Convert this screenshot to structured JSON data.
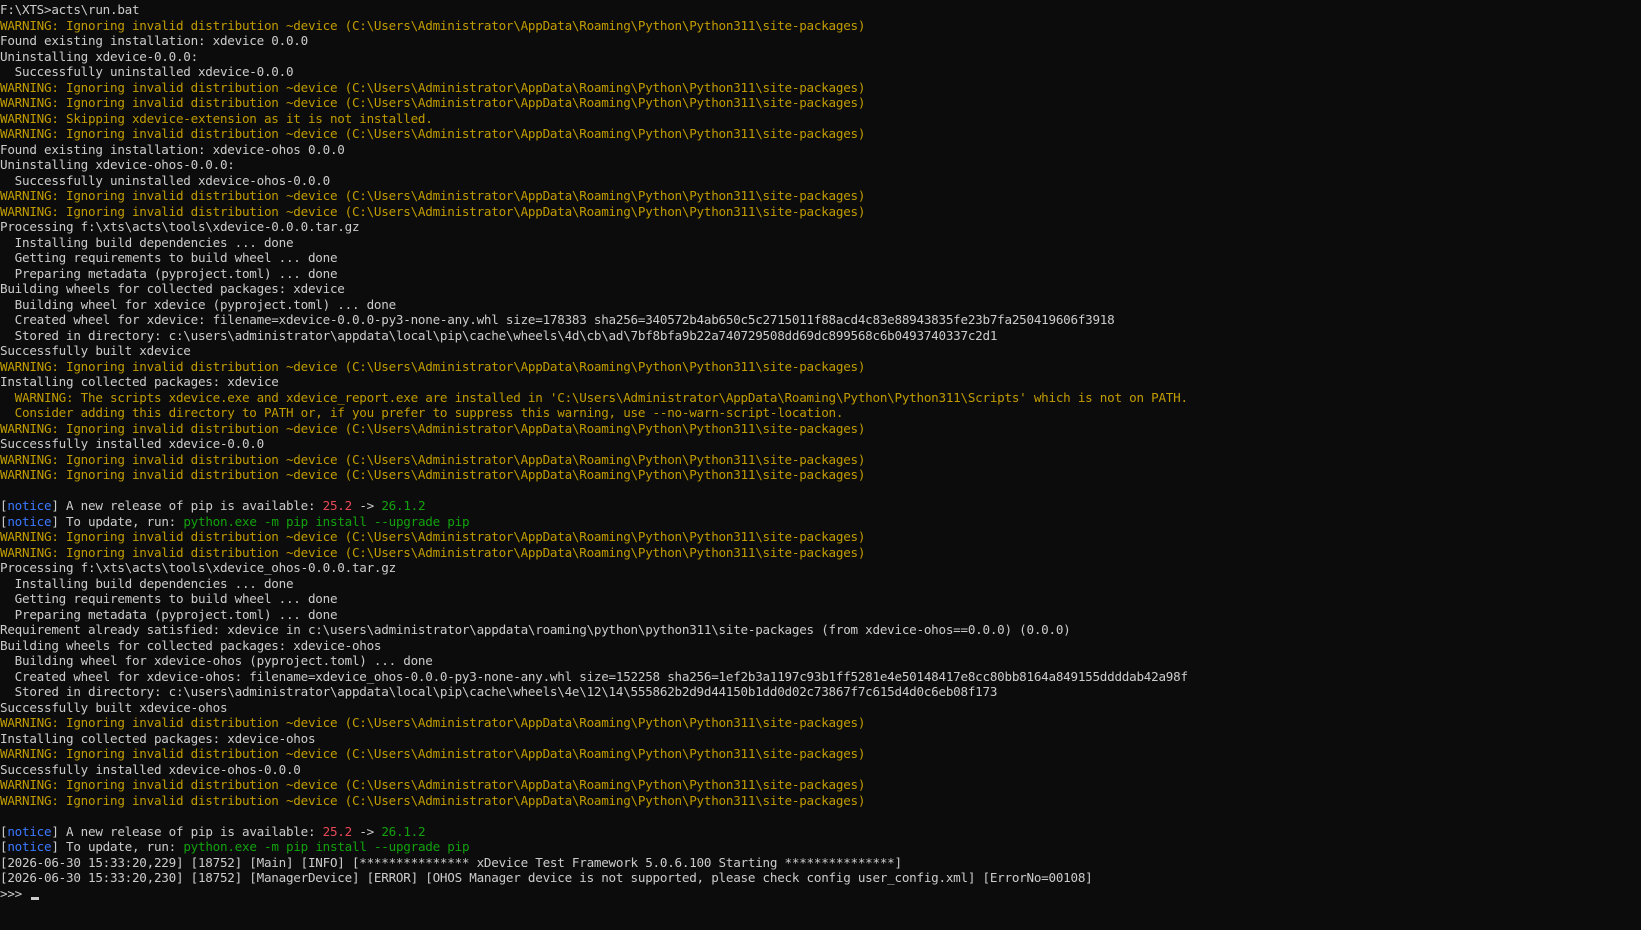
{
  "colors": {
    "background": "#0c0c0c",
    "text": "#cccccc",
    "warning": "#c19c00",
    "notice": "#3b78ff",
    "old_version": "#e74856",
    "new_version": "#13a10e"
  },
  "lines": [
    {
      "type": "n",
      "text": "F:\\XTS>acts\\run.bat"
    },
    {
      "type": "w",
      "text": "WARNING: Ignoring invalid distribution ~device (C:\\Users\\Administrator\\AppData\\Roaming\\Python\\Python311\\site-packages)"
    },
    {
      "type": "n",
      "text": "Found existing installation: xdevice 0.0.0"
    },
    {
      "type": "n",
      "text": "Uninstalling xdevice-0.0.0:"
    },
    {
      "type": "n",
      "text": "  Successfully uninstalled xdevice-0.0.0"
    },
    {
      "type": "w",
      "text": "WARNING: Ignoring invalid distribution ~device (C:\\Users\\Administrator\\AppData\\Roaming\\Python\\Python311\\site-packages)"
    },
    {
      "type": "w",
      "text": "WARNING: Ignoring invalid distribution ~device (C:\\Users\\Administrator\\AppData\\Roaming\\Python\\Python311\\site-packages)"
    },
    {
      "type": "w",
      "text": "WARNING: Skipping xdevice-extension as it is not installed."
    },
    {
      "type": "w",
      "text": "WARNING: Ignoring invalid distribution ~device (C:\\Users\\Administrator\\AppData\\Roaming\\Python\\Python311\\site-packages)"
    },
    {
      "type": "n",
      "text": "Found existing installation: xdevice-ohos 0.0.0"
    },
    {
      "type": "n",
      "text": "Uninstalling xdevice-ohos-0.0.0:"
    },
    {
      "type": "n",
      "text": "  Successfully uninstalled xdevice-ohos-0.0.0"
    },
    {
      "type": "w",
      "text": "WARNING: Ignoring invalid distribution ~device (C:\\Users\\Administrator\\AppData\\Roaming\\Python\\Python311\\site-packages)"
    },
    {
      "type": "w",
      "text": "WARNING: Ignoring invalid distribution ~device (C:\\Users\\Administrator\\AppData\\Roaming\\Python\\Python311\\site-packages)"
    },
    {
      "type": "n",
      "text": "Processing f:\\xts\\acts\\tools\\xdevice-0.0.0.tar.gz"
    },
    {
      "type": "n",
      "text": "  Installing build dependencies ... done"
    },
    {
      "type": "n",
      "text": "  Getting requirements to build wheel ... done"
    },
    {
      "type": "n",
      "text": "  Preparing metadata (pyproject.toml) ... done"
    },
    {
      "type": "n",
      "text": "Building wheels for collected packages: xdevice"
    },
    {
      "type": "n",
      "text": "  Building wheel for xdevice (pyproject.toml) ... done"
    },
    {
      "type": "n",
      "text": "  Created wheel for xdevice: filename=xdevice-0.0.0-py3-none-any.whl size=178383 sha256=340572b4ab650c5c2715011f88acd4c83e88943835fe23b7fa250419606f3918"
    },
    {
      "type": "n",
      "text": "  Stored in directory: c:\\users\\administrator\\appdata\\local\\pip\\cache\\wheels\\4d\\cb\\ad\\7bf8bfa9b22a740729508dd69dc899568c6b0493740337c2d1"
    },
    {
      "type": "n",
      "text": "Successfully built xdevice"
    },
    {
      "type": "w",
      "text": "WARNING: Ignoring invalid distribution ~device (C:\\Users\\Administrator\\AppData\\Roaming\\Python\\Python311\\site-packages)"
    },
    {
      "type": "n",
      "text": "Installing collected packages: xdevice"
    },
    {
      "type": "w",
      "text": "  WARNING: The scripts xdevice.exe and xdevice_report.exe are installed in 'C:\\Users\\Administrator\\AppData\\Roaming\\Python\\Python311\\Scripts' which is not on PATH."
    },
    {
      "type": "w",
      "text": "  Consider adding this directory to PATH or, if you prefer to suppress this warning, use --no-warn-script-location."
    },
    {
      "type": "w",
      "text": "WARNING: Ignoring invalid distribution ~device (C:\\Users\\Administrator\\AppData\\Roaming\\Python\\Python311\\site-packages)"
    },
    {
      "type": "n",
      "text": "Successfully installed xdevice-0.0.0"
    },
    {
      "type": "w",
      "text": "WARNING: Ignoring invalid distribution ~device (C:\\Users\\Administrator\\AppData\\Roaming\\Python\\Python311\\site-packages)"
    },
    {
      "type": "w",
      "text": "WARNING: Ignoring invalid distribution ~device (C:\\Users\\Administrator\\AppData\\Roaming\\Python\\Python311\\site-packages)"
    },
    {
      "type": "blank",
      "text": ""
    },
    {
      "type": "notice_release",
      "tag": "notice",
      "text": "A new release of pip is available: ",
      "old": "25.2",
      "arrow": " -> ",
      "new": "26.1.2"
    },
    {
      "type": "notice_update",
      "tag": "notice",
      "text": "To update, run: ",
      "cmd": "python.exe -m pip install --upgrade pip"
    },
    {
      "type": "w",
      "text": "WARNING: Ignoring invalid distribution ~device (C:\\Users\\Administrator\\AppData\\Roaming\\Python\\Python311\\site-packages)"
    },
    {
      "type": "w",
      "text": "WARNING: Ignoring invalid distribution ~device (C:\\Users\\Administrator\\AppData\\Roaming\\Python\\Python311\\site-packages)"
    },
    {
      "type": "n",
      "text": "Processing f:\\xts\\acts\\tools\\xdevice_ohos-0.0.0.tar.gz"
    },
    {
      "type": "n",
      "text": "  Installing build dependencies ... done"
    },
    {
      "type": "n",
      "text": "  Getting requirements to build wheel ... done"
    },
    {
      "type": "n",
      "text": "  Preparing metadata (pyproject.toml) ... done"
    },
    {
      "type": "n",
      "text": "Requirement already satisfied: xdevice in c:\\users\\administrator\\appdata\\roaming\\python\\python311\\site-packages (from xdevice-ohos==0.0.0) (0.0.0)"
    },
    {
      "type": "n",
      "text": "Building wheels for collected packages: xdevice-ohos"
    },
    {
      "type": "n",
      "text": "  Building wheel for xdevice-ohos (pyproject.toml) ... done"
    },
    {
      "type": "n",
      "text": "  Created wheel for xdevice-ohos: filename=xdevice_ohos-0.0.0-py3-none-any.whl size=152258 sha256=1ef2b3a1197c93b1ff5281e4e50148417e8cc80bb8164a849155ddddab42a98f"
    },
    {
      "type": "n",
      "text": "  Stored in directory: c:\\users\\administrator\\appdata\\local\\pip\\cache\\wheels\\4e\\12\\14\\555862b2d9d44150b1dd0d02c73867f7c615d4d0c6eb08f173"
    },
    {
      "type": "n",
      "text": "Successfully built xdevice-ohos"
    },
    {
      "type": "w",
      "text": "WARNING: Ignoring invalid distribution ~device (C:\\Users\\Administrator\\AppData\\Roaming\\Python\\Python311\\site-packages)"
    },
    {
      "type": "n",
      "text": "Installing collected packages: xdevice-ohos"
    },
    {
      "type": "w",
      "text": "WARNING: Ignoring invalid distribution ~device (C:\\Users\\Administrator\\AppData\\Roaming\\Python\\Python311\\site-packages)"
    },
    {
      "type": "n",
      "text": "Successfully installed xdevice-ohos-0.0.0"
    },
    {
      "type": "w",
      "text": "WARNING: Ignoring invalid distribution ~device (C:\\Users\\Administrator\\AppData\\Roaming\\Python\\Python311\\site-packages)"
    },
    {
      "type": "w",
      "text": "WARNING: Ignoring invalid distribution ~device (C:\\Users\\Administrator\\AppData\\Roaming\\Python\\Python311\\site-packages)"
    },
    {
      "type": "blank",
      "text": ""
    },
    {
      "type": "notice_release",
      "tag": "notice",
      "text": "A new release of pip is available: ",
      "old": "25.2",
      "arrow": " -> ",
      "new": "26.1.2"
    },
    {
      "type": "notice_update",
      "tag": "notice",
      "text": "To update, run: ",
      "cmd": "python.exe -m pip install --upgrade pip"
    },
    {
      "type": "n",
      "text": "[2026-06-30 15:33:20,229] [18752] [Main] [INFO] [*************** xDevice Test Framework 5.0.6.100 Starting ***************]"
    },
    {
      "type": "n",
      "text": "[2026-06-30 15:33:20,230] [18752] [ManagerDevice] [ERROR] [OHOS Manager device is not supported, please check config user_config.xml] [ErrorNo=00108]"
    },
    {
      "type": "prompt",
      "text": ">>> "
    }
  ]
}
